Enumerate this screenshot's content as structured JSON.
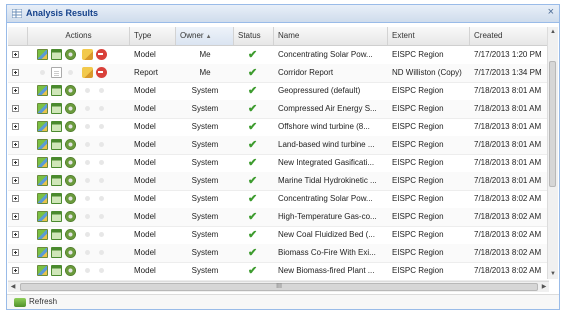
{
  "window": {
    "title": "Analysis Results",
    "close_glyph": "×"
  },
  "columns": {
    "actions": "Actions",
    "type": "Type",
    "owner": "Owner",
    "owner_sort": "▲",
    "status": "Status",
    "name": "Name",
    "extent": "Extent",
    "created": "Created"
  },
  "status_glyph": "✔",
  "rows": [
    {
      "type": "Model",
      "owner": "Me",
      "name": "Concentrating Solar Pow...",
      "extent": "EISPC Region",
      "created": "7/17/2013 1:20 PM",
      "icons": "model-editable"
    },
    {
      "type": "Report",
      "owner": "Me",
      "name": "Corridor Report",
      "extent": "ND Williston (Copy)",
      "created": "7/17/2013 1:34 PM",
      "icons": "report"
    },
    {
      "type": "Model",
      "owner": "System",
      "name": "Geopressured (default)",
      "extent": "EISPC Region",
      "created": "7/18/2013 8:01 AM",
      "icons": "model"
    },
    {
      "type": "Model",
      "owner": "System",
      "name": "Compressed Air Energy S...",
      "extent": "EISPC Region",
      "created": "7/18/2013 8:01 AM",
      "icons": "model"
    },
    {
      "type": "Model",
      "owner": "System",
      "name": "Offshore wind turbine (8...",
      "extent": "EISPC Region",
      "created": "7/18/2013 8:01 AM",
      "icons": "model"
    },
    {
      "type": "Model",
      "owner": "System",
      "name": "Land-based wind turbine ...",
      "extent": "EISPC Region",
      "created": "7/18/2013 8:01 AM",
      "icons": "model"
    },
    {
      "type": "Model",
      "owner": "System",
      "name": "New Integrated Gasificati...",
      "extent": "EISPC Region",
      "created": "7/18/2013 8:01 AM",
      "icons": "model"
    },
    {
      "type": "Model",
      "owner": "System",
      "name": "Marine Tidal Hydrokinetic ...",
      "extent": "EISPC Region",
      "created": "7/18/2013 8:01 AM",
      "icons": "model"
    },
    {
      "type": "Model",
      "owner": "System",
      "name": "Concentrating Solar Pow...",
      "extent": "EISPC Region",
      "created": "7/18/2013 8:02 AM",
      "icons": "model"
    },
    {
      "type": "Model",
      "owner": "System",
      "name": "High-Temperature Gas-co...",
      "extent": "EISPC Region",
      "created": "7/18/2013 8:02 AM",
      "icons": "model"
    },
    {
      "type": "Model",
      "owner": "System",
      "name": "New Coal Fluidized Bed (...",
      "extent": "EISPC Region",
      "created": "7/18/2013 8:02 AM",
      "icons": "model"
    },
    {
      "type": "Model",
      "owner": "System",
      "name": "Biomass Co-Fire With Exi...",
      "extent": "EISPC Region",
      "created": "7/18/2013 8:02 AM",
      "icons": "model"
    },
    {
      "type": "Model",
      "owner": "System",
      "name": "New Biomass-fired Plant ...",
      "extent": "EISPC Region",
      "created": "7/18/2013 8:02 AM",
      "icons": "model"
    }
  ],
  "scrollbar": {
    "grip": "III",
    "up": "▲",
    "down": "▼",
    "left": "◀",
    "right": "▶"
  },
  "footer": {
    "refresh_label": "Refresh"
  },
  "colors": {
    "status_ok": "#3d9b2e",
    "title_text": "#15428b",
    "border": "#99bbe8"
  }
}
